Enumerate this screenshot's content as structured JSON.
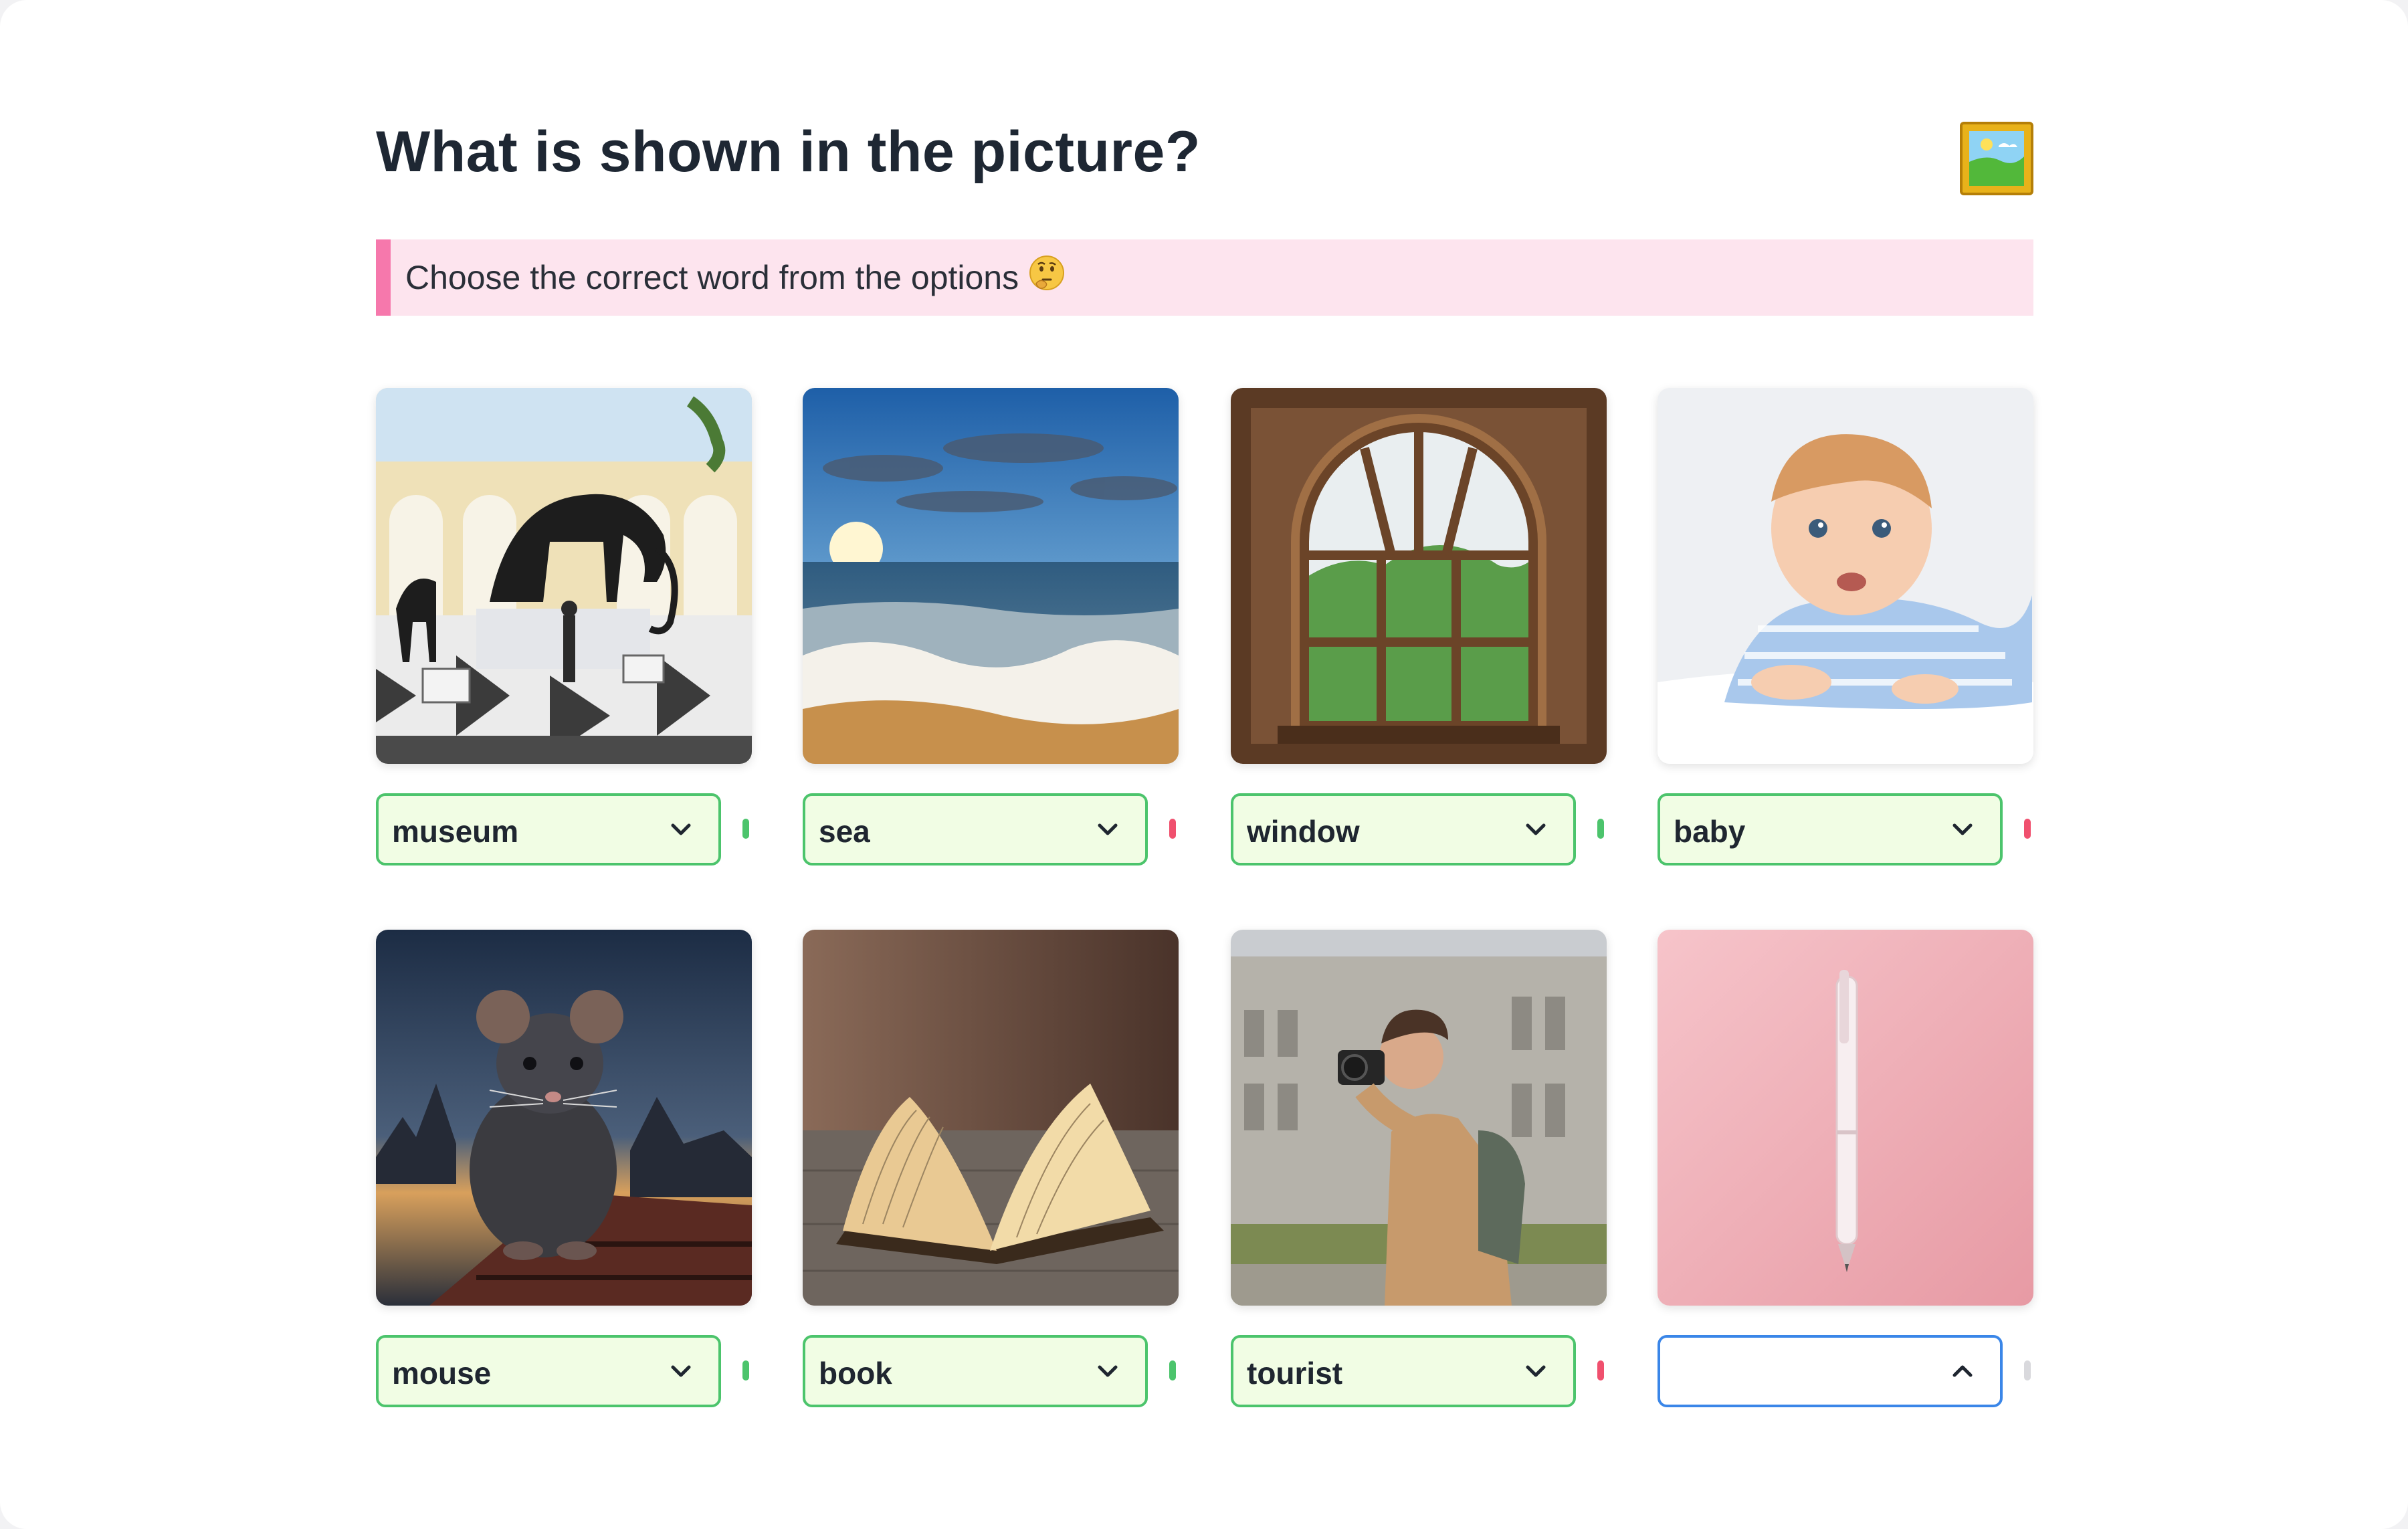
{
  "header": {
    "title": "What is shown in the picture?",
    "title_icon": "framed-picture-icon"
  },
  "instruction": {
    "text": "Choose the correct word from the options",
    "icon": "thinking-face-icon",
    "accent_color": "#f678ac",
    "background_color": "#fde4ee"
  },
  "colors": {
    "correct": "#4cc46c",
    "incorrect": "#f0506e",
    "pending": "#d9d9dd",
    "answered_fill": "#f1fde4",
    "focused_border": "#3a86e8"
  },
  "items": [
    {
      "image": "museum-photo",
      "selected": "museum",
      "status": "correct",
      "dropdown_open": false
    },
    {
      "image": "sea-photo",
      "selected": "sea",
      "status": "incorrect",
      "dropdown_open": false
    },
    {
      "image": "window-photo",
      "selected": "window",
      "status": "correct",
      "dropdown_open": false
    },
    {
      "image": "baby-photo",
      "selected": "baby",
      "status": "incorrect",
      "dropdown_open": false
    },
    {
      "image": "mouse-photo",
      "selected": "mouse",
      "status": "correct",
      "dropdown_open": false
    },
    {
      "image": "book-photo",
      "selected": "book",
      "status": "correct",
      "dropdown_open": false
    },
    {
      "image": "tourist-photo",
      "selected": "tourist",
      "status": "incorrect",
      "dropdown_open": false
    },
    {
      "image": "pen-photo",
      "selected": "",
      "status": "pending",
      "dropdown_open": true
    }
  ]
}
